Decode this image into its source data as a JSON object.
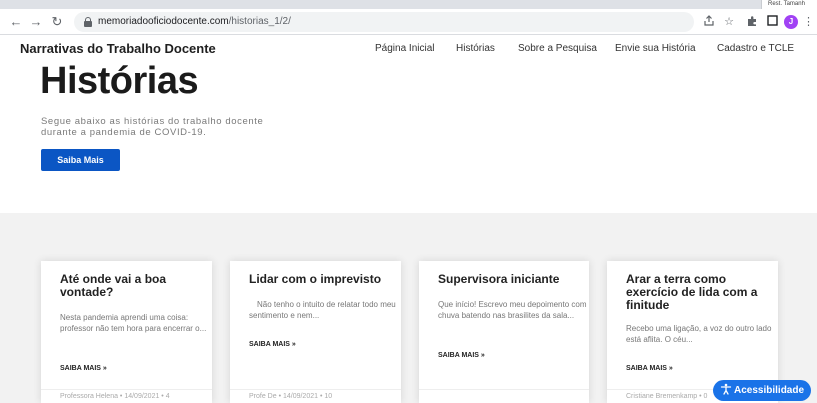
{
  "browser": {
    "tab_hint": "Rest. Tamanh",
    "url_host": "memoriadooficiodocente.com",
    "url_path": "/historias_1/2/",
    "back_glyph": "←",
    "forward_glyph": "→",
    "reload_glyph": "↻",
    "profile_initial": "J",
    "icons": [
      "share-icon",
      "star-icon",
      "extensions-icon",
      "sidebar-icon",
      "profile-avatar",
      "menu-icon"
    ]
  },
  "header": {
    "site_title": "Narrativas do Trabalho Docente",
    "nav": [
      "Página Inicial",
      "Histórias",
      "Sobre a Pesquisa",
      "Envie sua História",
      "Cadastro e TCLE"
    ]
  },
  "hero": {
    "title": "Histórias",
    "subtitle": "Segue abaixo as histórias do trabalho docente durante a pandemia de COVID-19.",
    "button": "Saiba Mais"
  },
  "cards": [
    {
      "title": "Até onde vai a boa vontade?",
      "excerpt": "Nesta pandemia aprendi uma coisa: professor não tem hora para encerrar o...",
      "more": "SAIBA MAIS »",
      "meta": "Professora Helena • 14/09/2021 • 4"
    },
    {
      "title": "Lidar com o imprevisto",
      "excerpt": "Não tenho o intuito de relatar todo meu sentimento e nem...",
      "more": "SAIBA MAIS »",
      "meta": "Profe De • 14/09/2021 • 10"
    },
    {
      "title": "Supervisora iniciante",
      "excerpt": "Que início! Escrevo meu depoimento com chuva batendo nas brasilites da sala...",
      "more": "SAIBA MAIS »",
      "meta": ""
    },
    {
      "title": "Arar a terra como exercício de lida com a finitude",
      "excerpt": "Recebo uma ligação, a voz do outro lado está aflita. O céu...",
      "more": "SAIBA MAIS »",
      "meta": "Cristiane Bremenkamp • 0"
    }
  ],
  "accessibility": {
    "label": "Acessibilidade",
    "color": "#1a73e8"
  },
  "colors": {
    "primary_button": "#0b56c4",
    "section_bg": "#f2f2f2"
  }
}
